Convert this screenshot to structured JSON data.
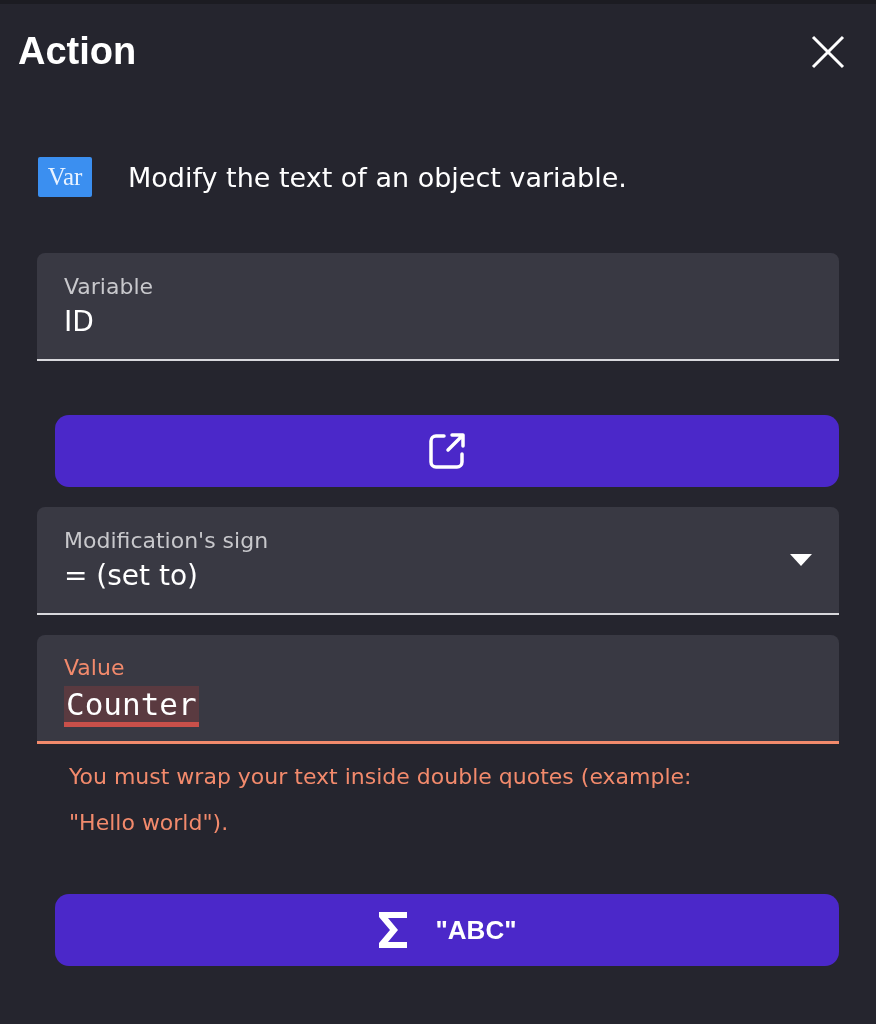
{
  "dialog": {
    "title": "Action"
  },
  "description": {
    "icon_text": "Var",
    "text": "Modify the text of an object variable."
  },
  "fields": [
    {
      "kind": "text",
      "label": "Variable",
      "value": "ID",
      "error": false
    },
    {
      "kind": "button"
    },
    {
      "kind": "select",
      "label": "Modification's sign",
      "value": "= (set to)",
      "error": false
    },
    {
      "kind": "expression",
      "label": "Value",
      "value": "Counter",
      "error": true,
      "helper": "You must wrap your text inside double quotes (example: \"Hello world\")."
    },
    {
      "kind": "button",
      "text": "\"ABC\""
    }
  ]
}
